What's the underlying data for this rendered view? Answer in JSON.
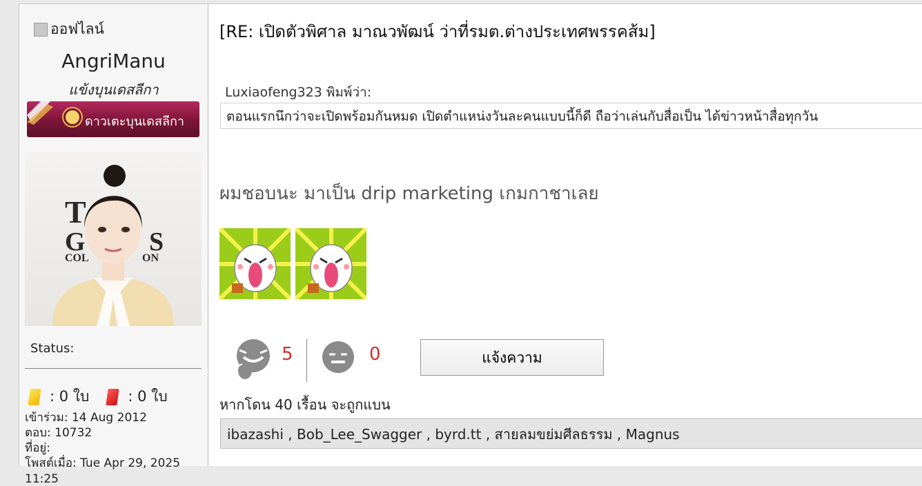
{
  "user": {
    "status": "ออฟไลน์",
    "username": "AngriManu",
    "title": "แข้งบุนเดสลีกา",
    "rank_badge": "ดาวเตะบุนเดสลีกา",
    "status_label": "Status:",
    "yellow_cards": ": 0 ใบ",
    "red_cards": ": 0 ใบ",
    "joined": "เข้าร่วม: 14 Aug 2012",
    "replies": "ตอบ: 10732",
    "location": "ที่อยู่:",
    "last_post_partial": "โพสต์เมื่อ: Tue Apr 29, 2025 11:25"
  },
  "post": {
    "title": "[RE: เปิดตัวพิศาล มาณวพัฒน์ ว่าที่รมต.ต่างประเทศพรรคส้ม]",
    "quote_author": "Luxiaofeng323 พิมพ์ว่า:",
    "quote_text": "ตอนแรกนึกว่าจะเปิดพร้อมกันหมด เปิดตำแหน่งวันละคนแบบนี้ก็ดี ถือว่าเล่นกับสื่อเป็น ได้ข่าวหน้าสื่อทุกวัน",
    "body": "ผมชอบนะ มาเป็น drip marketing เกมกาชาเลย"
  },
  "votes": {
    "like_count": "5",
    "dislike_count": "0",
    "report_label": "แจ้งความ"
  },
  "warnings": {
    "ban_note": "หากโดน 40 เรื้อน จะถูกแบน",
    "users": "ibazashi , Bob_Lee_Swagger , byrd.tt , สายลมขย่มศีลธรรม , Magnus"
  },
  "colors": {
    "badge": "#7d1538",
    "count": "#d03030",
    "sticker_bg": "#9ccc1a"
  }
}
